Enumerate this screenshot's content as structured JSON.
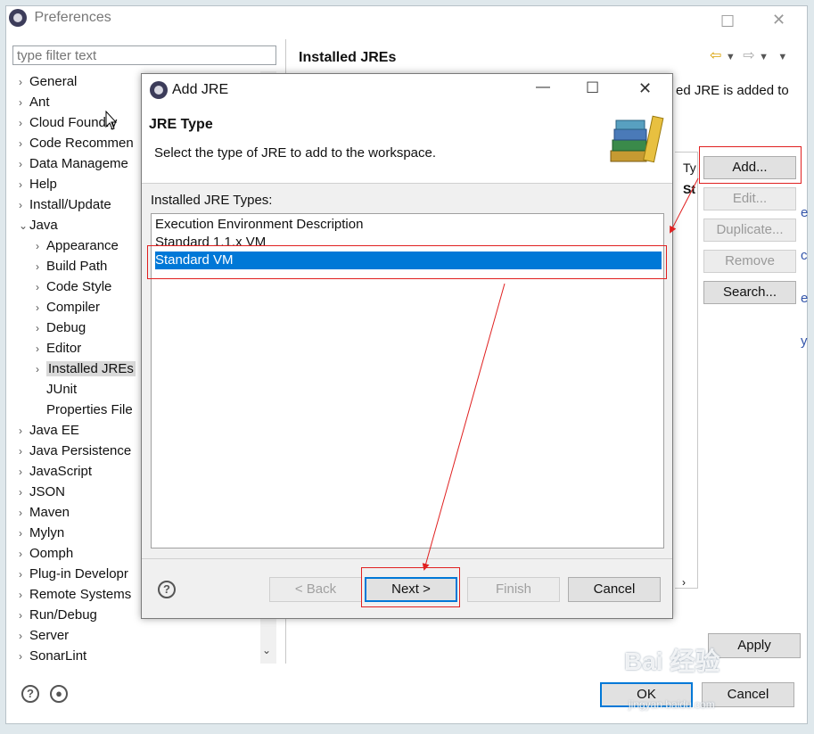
{
  "preferences": {
    "title": "Preferences",
    "filter_placeholder": "type filter text",
    "tree": [
      {
        "label": "General",
        "chevron": "›"
      },
      {
        "label": "Ant",
        "chevron": "›"
      },
      {
        "label": "Cloud Foundry",
        "chevron": "›"
      },
      {
        "label": "Code Recommen",
        "chevron": "›"
      },
      {
        "label": "Data Manageme",
        "chevron": "›"
      },
      {
        "label": "Help",
        "chevron": "›"
      },
      {
        "label": "Install/Update",
        "chevron": "›"
      },
      {
        "label": "Java",
        "chevron": "⌄"
      },
      {
        "label": "Appearance",
        "chevron": "›"
      },
      {
        "label": "Build Path",
        "chevron": "›"
      },
      {
        "label": "Code Style",
        "chevron": "›"
      },
      {
        "label": "Compiler",
        "chevron": "›"
      },
      {
        "label": "Debug",
        "chevron": "›"
      },
      {
        "label": "Editor",
        "chevron": "›"
      },
      {
        "label": "Installed JREs",
        "chevron": "›"
      },
      {
        "label": "JUnit",
        "chevron": ""
      },
      {
        "label": "Properties File",
        "chevron": ""
      },
      {
        "label": "Java EE",
        "chevron": "›"
      },
      {
        "label": "Java Persistence",
        "chevron": "›"
      },
      {
        "label": "JavaScript",
        "chevron": "›"
      },
      {
        "label": "JSON",
        "chevron": "›"
      },
      {
        "label": "Maven",
        "chevron": "›"
      },
      {
        "label": "Mylyn",
        "chevron": "›"
      },
      {
        "label": "Oomph",
        "chevron": "›"
      },
      {
        "label": "Plug-in Developr",
        "chevron": "›"
      },
      {
        "label": "Remote Systems",
        "chevron": "›"
      },
      {
        "label": "Run/Debug",
        "chevron": "›"
      },
      {
        "label": "Server",
        "chevron": "›"
      },
      {
        "label": "SonarLint",
        "chevron": "›"
      }
    ],
    "right_title": "Installed JREs",
    "right_desc": "ed JRE is added to",
    "col_type": "Ty",
    "cell_type": "St",
    "buttons": {
      "add": "Add...",
      "edit": "Edit...",
      "duplicate": "Duplicate...",
      "remove": "Remove",
      "search": "Search...",
      "apply": "Apply",
      "ok": "OK",
      "cancel": "Cancel"
    }
  },
  "dialog": {
    "title": "Add JRE",
    "heading": "JRE Type",
    "subtitle": "Select the type of JRE to add to the workspace.",
    "list_label": "Installed JRE Types:",
    "types": [
      "Execution Environment Description",
      "Standard 1.1.x VM",
      "Standard VM"
    ],
    "buttons": {
      "back": "< Back",
      "next": "Next >",
      "finish": "Finish",
      "cancel": "Cancel"
    }
  },
  "watermark": {
    "text": "Bai 经验",
    "url": "jingyan.baidu.com"
  },
  "colors": {
    "selection": "#0078d7",
    "annotation": "#e02020"
  }
}
